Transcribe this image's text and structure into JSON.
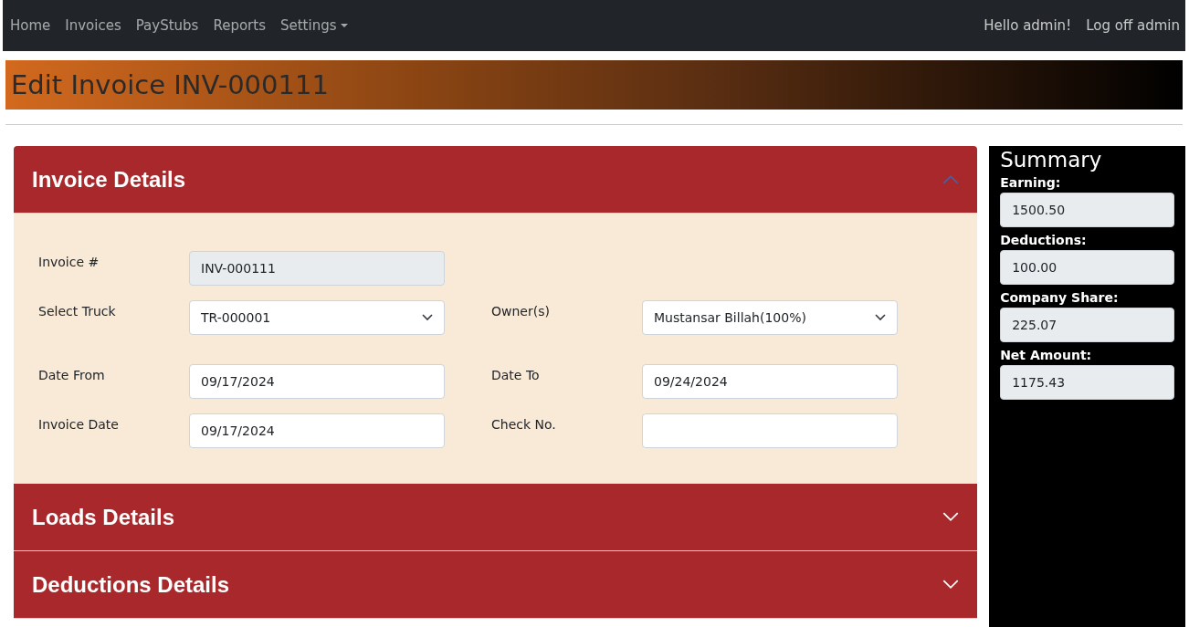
{
  "navbar": {
    "links": [
      {
        "label": "Home",
        "dropdown": false
      },
      {
        "label": "Invoices",
        "dropdown": false
      },
      {
        "label": "PayStubs",
        "dropdown": false
      },
      {
        "label": "Reports",
        "dropdown": false
      },
      {
        "label": "Settings",
        "dropdown": true
      }
    ],
    "right_links": [
      "Hello admin!",
      "Log off admin"
    ]
  },
  "page_title": "Edit Invoice INV-000111",
  "sections": [
    {
      "title": "Invoice Details",
      "expanded": true,
      "rows": [
        [
          {
            "label": "Invoice #",
            "kind": "readonly",
            "value": "INV-000111"
          }
        ],
        [
          {
            "label": "Select Truck",
            "kind": "select",
            "value": "TR-000001"
          },
          {
            "label": "Owner(s)",
            "kind": "select",
            "value": "Mustansar Billah(100%)"
          }
        ],
        [
          {
            "label": "Date From",
            "kind": "input",
            "value": "09/17/2024"
          },
          {
            "label": "Date To",
            "kind": "input",
            "value": "09/24/2024"
          }
        ],
        [
          {
            "label": "Invoice Date",
            "kind": "input",
            "value": "09/17/2024"
          },
          {
            "label": "Check No.",
            "kind": "input"
          }
        ]
      ]
    },
    {
      "title": "Loads Details",
      "expanded": false
    },
    {
      "title": "Deductions Details",
      "expanded": false
    }
  ],
  "summary": {
    "title": "Summary",
    "items": [
      {
        "label": "Earning:",
        "value": "1500.50"
      },
      {
        "label": "Deductions:",
        "value": "100.00"
      },
      {
        "label": "Company Share:",
        "value": "225.07"
      },
      {
        "label": "Net Amount:",
        "value": "1175.43"
      }
    ]
  }
}
